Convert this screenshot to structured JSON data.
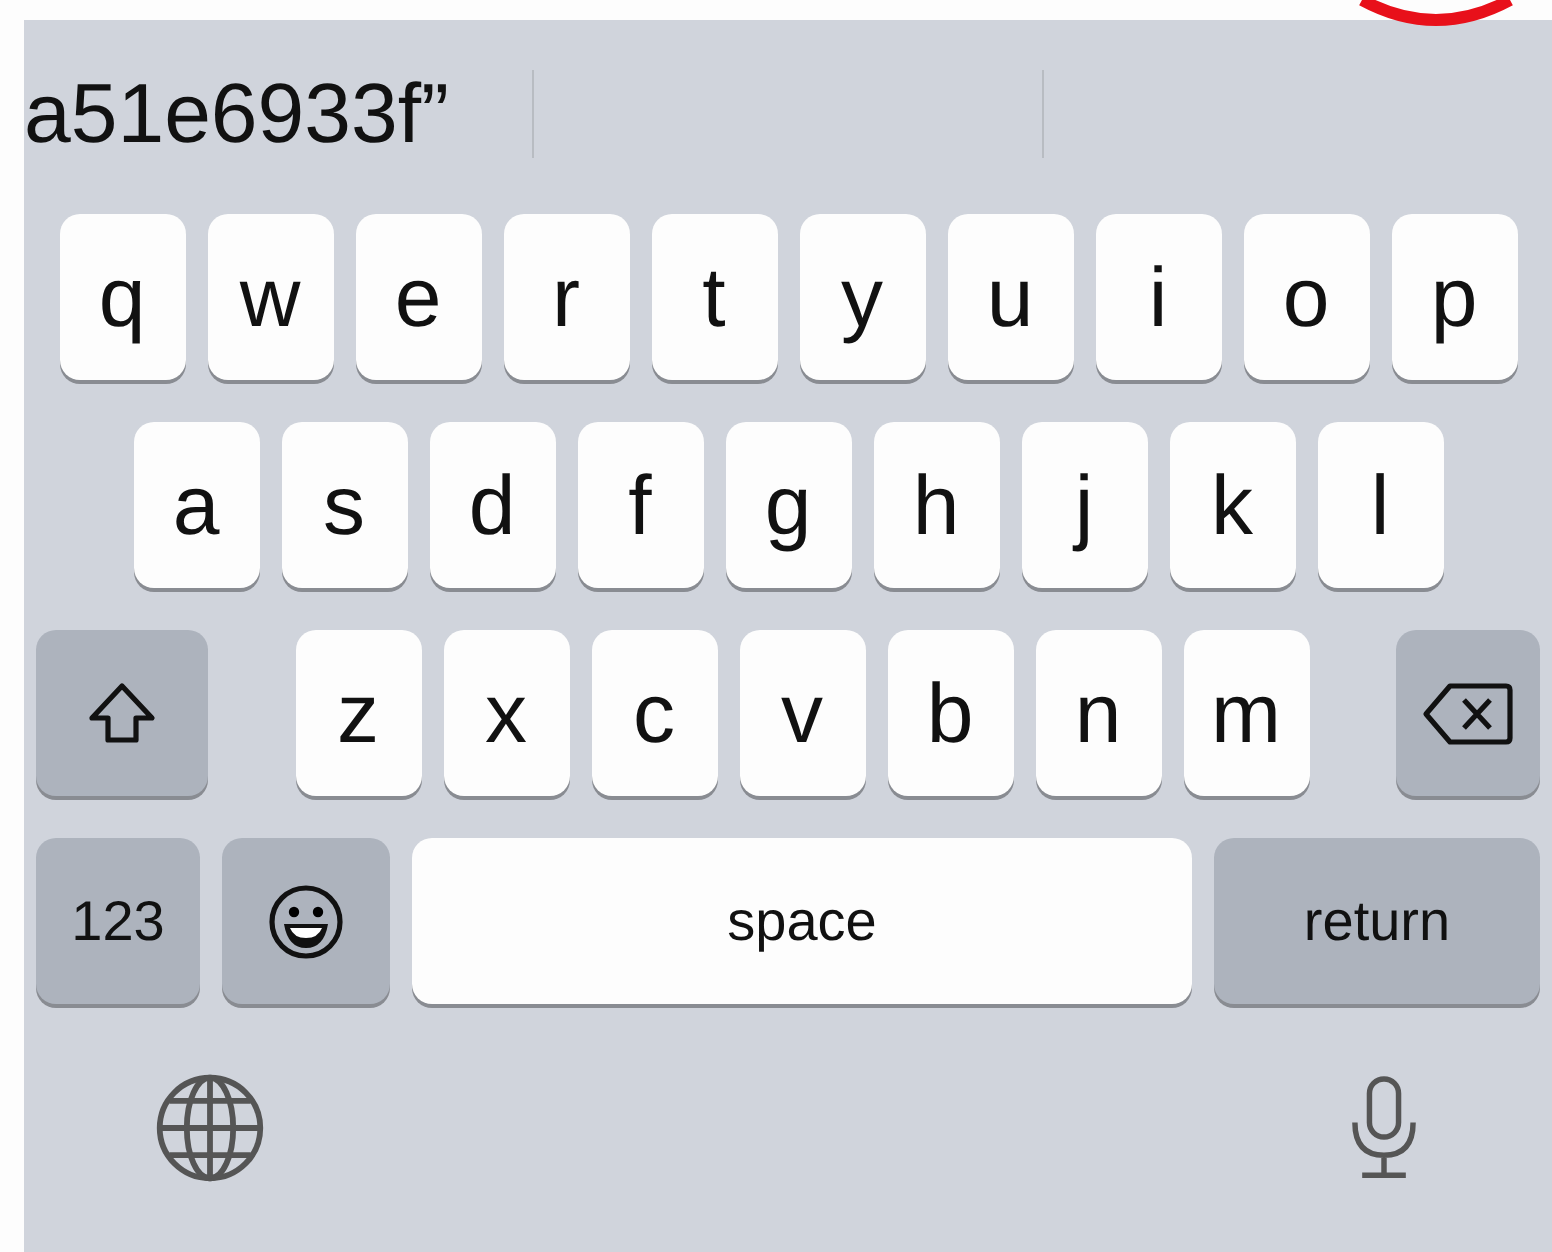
{
  "suggestions": [
    "a51e6933f”"
  ],
  "rows": [
    {
      "keys": [
        {
          "kind": "letter",
          "label": "q"
        },
        {
          "kind": "letter",
          "label": "w"
        },
        {
          "kind": "letter",
          "label": "e"
        },
        {
          "kind": "letter",
          "label": "r"
        },
        {
          "kind": "letter",
          "label": "t"
        },
        {
          "kind": "letter",
          "label": "y"
        },
        {
          "kind": "letter",
          "label": "u"
        },
        {
          "kind": "letter",
          "label": "i"
        },
        {
          "kind": "letter",
          "label": "o"
        },
        {
          "kind": "letter",
          "label": "p"
        }
      ]
    },
    {
      "keys": [
        {
          "kind": "letter",
          "label": "a"
        },
        {
          "kind": "letter",
          "label": "s"
        },
        {
          "kind": "letter",
          "label": "d"
        },
        {
          "kind": "letter",
          "label": "f"
        },
        {
          "kind": "letter",
          "label": "g"
        },
        {
          "kind": "letter",
          "label": "h"
        },
        {
          "kind": "letter",
          "label": "j"
        },
        {
          "kind": "letter",
          "label": "k"
        },
        {
          "kind": "letter",
          "label": "l"
        }
      ]
    },
    {
      "keys": [
        {
          "kind": "shift"
        },
        {
          "kind": "letter",
          "label": "z"
        },
        {
          "kind": "letter",
          "label": "x"
        },
        {
          "kind": "letter",
          "label": "c"
        },
        {
          "kind": "letter",
          "label": "v"
        },
        {
          "kind": "letter",
          "label": "b"
        },
        {
          "kind": "letter",
          "label": "n"
        },
        {
          "kind": "letter",
          "label": "m"
        },
        {
          "kind": "delete"
        }
      ]
    },
    {
      "keys": [
        {
          "kind": "numbers",
          "label": "123"
        },
        {
          "kind": "emoji"
        },
        {
          "kind": "space",
          "label": "space"
        },
        {
          "kind": "return",
          "label": "return"
        }
      ]
    }
  ],
  "bottom": [
    {
      "kind": "globe"
    },
    {
      "kind": "mic"
    }
  ]
}
